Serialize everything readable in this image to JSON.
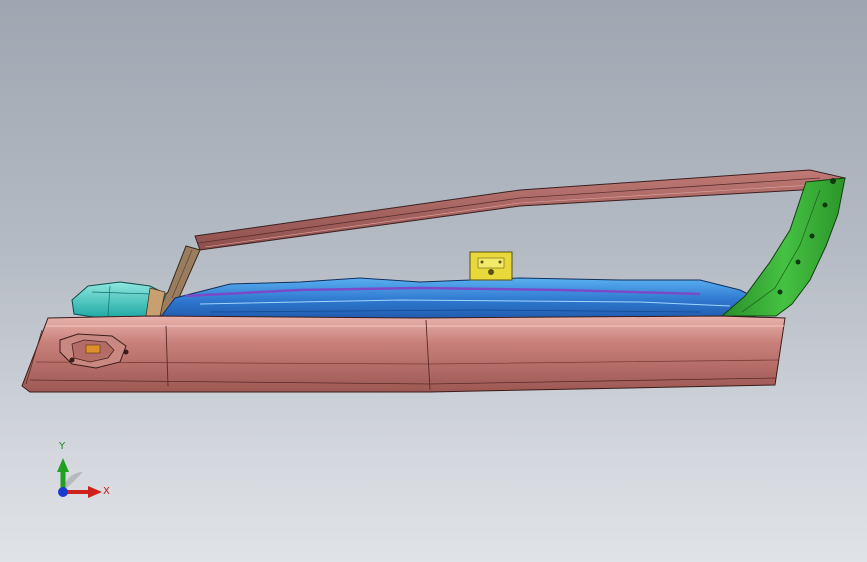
{
  "view_triad": {
    "y_label": "Y",
    "x_label": "X"
  },
  "colors": {
    "background_top": "#9ea6b1",
    "background_bottom": "#e0e3e7",
    "sill_panel": "#c2756f",
    "roof_rail": "#a8605e",
    "green_pillar": "#35a832",
    "blue_reinforcement": "#3a86d9",
    "cyan_part": "#33c4c0",
    "yellow_bracket": "#e8d83a",
    "axis_x": "#d0201c",
    "axis_y": "#22a022",
    "axis_z": "#1a3ad0"
  }
}
